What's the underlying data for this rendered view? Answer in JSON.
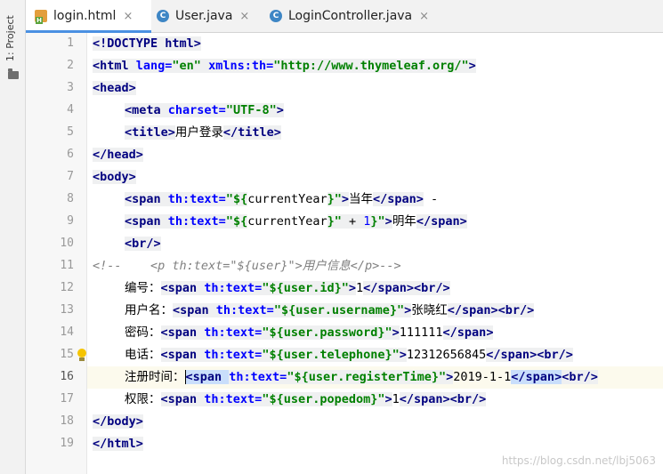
{
  "sidebar": {
    "project_label": "1: Project"
  },
  "tabs": [
    {
      "label": "login.html",
      "icon": "html-file-icon",
      "active": true,
      "close": "×"
    },
    {
      "label": "User.java",
      "icon": "java-class-icon",
      "active": false,
      "close": "×"
    },
    {
      "label": "LoginController.java",
      "icon": "java-class-icon",
      "active": false,
      "close": "×"
    }
  ],
  "gutter": {
    "line_numbers": [
      "1",
      "2",
      "3",
      "4",
      "5",
      "6",
      "7",
      "8",
      "9",
      "10",
      "11",
      "12",
      "13",
      "14",
      "15",
      "16",
      "17",
      "18",
      "19"
    ],
    "current_line": 16,
    "bulb_line": 15
  },
  "code": [
    {
      "indent": 0,
      "tokens": [
        [
          "tag",
          "<!DOCTYPE "
        ],
        [
          "tag",
          "html"
        ],
        [
          "tag",
          ">"
        ]
      ]
    },
    {
      "indent": 0,
      "tokens": [
        [
          "tag",
          "<html "
        ],
        [
          "attr",
          "lang="
        ],
        [
          "str",
          "\"en\" "
        ],
        [
          "attr",
          "xmlns:th="
        ],
        [
          "str",
          "\"http://www.thymeleaf.org/\""
        ],
        [
          "tag",
          ">"
        ]
      ]
    },
    {
      "indent": 0,
      "tokens": [
        [
          "tag",
          "<head>"
        ]
      ]
    },
    {
      "indent": 1,
      "tokens": [
        [
          "tag",
          "<meta "
        ],
        [
          "attr",
          "charset="
        ],
        [
          "str",
          "\"UTF-8\""
        ],
        [
          "tag",
          ">"
        ]
      ]
    },
    {
      "indent": 1,
      "tokens": [
        [
          "tag",
          "<title>"
        ],
        [
          "txt",
          "用户登录"
        ],
        [
          "tag",
          "</title>"
        ]
      ]
    },
    {
      "indent": 0,
      "tokens": [
        [
          "tag",
          "</head>"
        ]
      ]
    },
    {
      "indent": 0,
      "tokens": [
        [
          "tag",
          "<body>"
        ]
      ]
    },
    {
      "indent": 1,
      "tokens": [
        [
          "tag",
          "<span "
        ],
        [
          "attr",
          "th:text="
        ],
        [
          "str",
          "\"${"
        ],
        [
          "txt",
          "currentYear"
        ],
        [
          "str",
          "}\""
        ],
        [
          "tag",
          ">"
        ],
        [
          "txt",
          "当年"
        ],
        [
          "tag",
          "</span>"
        ],
        [
          "txt",
          " -"
        ]
      ]
    },
    {
      "indent": 1,
      "tokens": [
        [
          "tag",
          "<span "
        ],
        [
          "attr",
          "th:text="
        ],
        [
          "str",
          "\"${"
        ],
        [
          "txt",
          "currentYear"
        ],
        [
          "str",
          "}\""
        ],
        [
          "op",
          " + "
        ],
        [
          "num",
          "1"
        ],
        [
          "str",
          "}\""
        ],
        [
          "tag",
          ">"
        ],
        [
          "txt",
          "明年"
        ],
        [
          "tag",
          "</span>"
        ]
      ]
    },
    {
      "indent": 1,
      "tokens": [
        [
          "tag",
          "<br/>"
        ]
      ]
    },
    {
      "indent": 0,
      "tokens": [
        [
          "comment",
          "<!--    <p th:text=\"${user}\">用户信息</p>-->"
        ]
      ]
    },
    {
      "indent": 1,
      "tokens": [
        [
          "txt",
          "编号："
        ],
        [
          "tag",
          "<span "
        ],
        [
          "attr",
          "th:text="
        ],
        [
          "str",
          "\"${user.id}\""
        ],
        [
          "tag",
          ">"
        ],
        [
          "txt",
          "1"
        ],
        [
          "tag",
          "</span><br/>"
        ]
      ]
    },
    {
      "indent": 1,
      "tokens": [
        [
          "txt",
          "用户名："
        ],
        [
          "tag",
          "<span "
        ],
        [
          "attr",
          "th:text="
        ],
        [
          "str",
          "\"${user.username}\""
        ],
        [
          "tag",
          ">"
        ],
        [
          "txt",
          "张晓红"
        ],
        [
          "tag",
          "</span><br/>"
        ]
      ]
    },
    {
      "indent": 1,
      "tokens": [
        [
          "txt",
          "密码："
        ],
        [
          "tag",
          "<span "
        ],
        [
          "attr",
          "th:text="
        ],
        [
          "str",
          "\"${user.password}\""
        ],
        [
          "tag",
          ">"
        ],
        [
          "txt",
          "111111"
        ],
        [
          "tag",
          "</span>"
        ]
      ]
    },
    {
      "indent": 1,
      "tokens": [
        [
          "txt",
          "电话："
        ],
        [
          "tag",
          "<span "
        ],
        [
          "attr",
          "th:text="
        ],
        [
          "str",
          "\"${user.telephone}\""
        ],
        [
          "tag",
          ">"
        ],
        [
          "txt",
          "12312656845"
        ],
        [
          "tag",
          "</span><br/>"
        ]
      ]
    },
    {
      "indent": 1,
      "tokens": [
        [
          "txt",
          "注册时间："
        ],
        [
          "caret",
          ""
        ],
        [
          "tagsel",
          "<span "
        ],
        [
          "attr",
          "th:text="
        ],
        [
          "str",
          "\"${user.registerTime}\""
        ],
        [
          "tag",
          ">"
        ],
        [
          "txt",
          "2019-1-1"
        ],
        [
          "tagsel",
          "</span>"
        ],
        [
          "tag",
          "<br/>"
        ]
      ]
    },
    {
      "indent": 1,
      "tokens": [
        [
          "txt",
          "权限："
        ],
        [
          "tag",
          "<span "
        ],
        [
          "attr",
          "th:text="
        ],
        [
          "str",
          "\"${user.popedom}\""
        ],
        [
          "tag",
          ">"
        ],
        [
          "txt",
          "1"
        ],
        [
          "tag",
          "</span><br/>"
        ]
      ]
    },
    {
      "indent": 0,
      "tokens": [
        [
          "tag",
          "</body>"
        ]
      ]
    },
    {
      "indent": 0,
      "tokens": [
        [
          "tag",
          "</html>"
        ]
      ]
    }
  ],
  "watermark": "https://blog.csdn.net/lbj5063",
  "colors": {
    "tag": "#000080",
    "attr": "#0000ff",
    "string": "#008000",
    "comment": "#808080",
    "accent": "#4a90e2"
  }
}
